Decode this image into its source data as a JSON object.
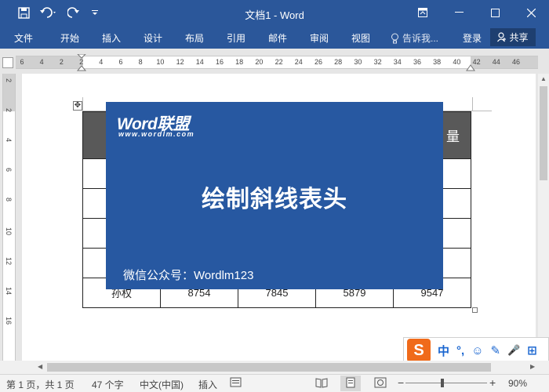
{
  "window": {
    "title": "文档1 - Word"
  },
  "ribbon": {
    "tabs": [
      "文件",
      "开始",
      "插入",
      "设计",
      "布局",
      "引用",
      "邮件",
      "审阅",
      "视图"
    ],
    "tell_me": "告诉我...",
    "login": "登录",
    "share": "共享"
  },
  "ruler": {
    "h_labels": [
      "6",
      "4",
      "2",
      "2",
      "4",
      "6",
      "8",
      "10",
      "12",
      "14",
      "16",
      "18",
      "20",
      "22",
      "24",
      "26",
      "28",
      "30",
      "32",
      "34",
      "36",
      "38",
      "40",
      "42",
      "44",
      "46"
    ],
    "v_labels": [
      "2",
      "2",
      "4",
      "6",
      "8",
      "10",
      "12",
      "14",
      "16"
    ]
  },
  "table": {
    "header_last": "量",
    "last_row": [
      "孙权",
      "8754",
      "7845",
      "5879",
      "9547"
    ]
  },
  "banner": {
    "brand": "Word联盟",
    "brand_url": "www.wordlm.com",
    "headline": "绘制斜线表头",
    "footer": "微信公众号：Wordlm123",
    "bg_color": "#2758a1"
  },
  "ime": {
    "logo": "S",
    "items": [
      "中",
      "°,",
      "☺",
      "✎",
      "🎤",
      "⊞"
    ]
  },
  "statusbar": {
    "page": "第 1 页，共 1 页",
    "words": "47 个字",
    "language": "中文(中国)",
    "mode": "插入",
    "zoom_level": "90%",
    "zoom_fraction": 0.45
  },
  "colors": {
    "accent": "#2b579a",
    "header_fill": "#595959"
  }
}
